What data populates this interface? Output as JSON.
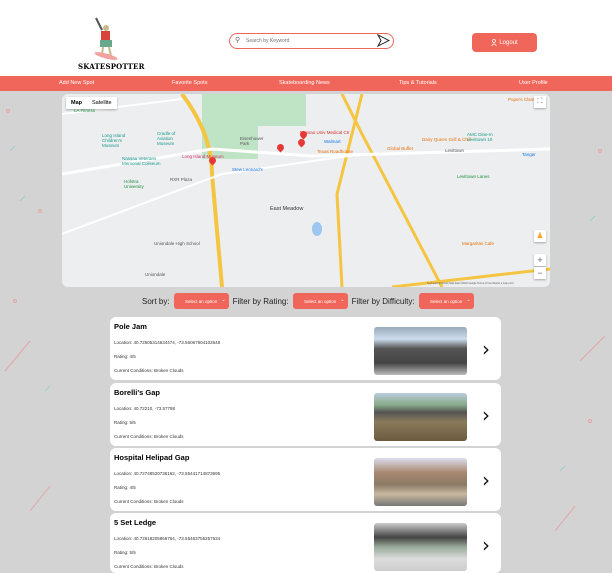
{
  "header": {
    "brand": "SKATESPOTTER",
    "search_placeholder": "Search by Keyword",
    "logout_label": "Logout"
  },
  "nav": [
    "Add New Spot",
    "Favorite Spots",
    "Skateboarding News",
    "Tips & Tutorials",
    "User Profile"
  ],
  "map": {
    "tabs": [
      "Map",
      "Satellite"
    ],
    "labels": [
      "East Meadow",
      "Levittown",
      "Uniondale",
      "Long Island Children's Museum",
      "Nassau Veterans Memorial Coliseum",
      "Long Island Museum",
      "Stew Leonard's",
      "Walmart",
      "Texas Roadhouse",
      "Global Buffet",
      "Levittown Lanes",
      "Uniondale High School",
      "RXR Plaza",
      "Hofstra University",
      "Dairy Queen Grill & Chill",
      "AMC Dine-In Levittown 10",
      "Tanger",
      "Margaritas Cafe",
      "Nassau Univ Medical Ctr",
      "Popei's Clam Bar",
      "LA Fitness",
      "Cradle of Aviation Museum",
      "Eisenhower Park"
    ],
    "zoom_in": "+",
    "zoom_out": "−",
    "attribution": "Keyboard shortcuts  Map data ©2023 Google  Terms of Use  Report a map error"
  },
  "filters": {
    "sort_label": "Sort by:",
    "rating_label": "Filter by Rating:",
    "difficulty_label": "Filter by Difficulty:",
    "placeholder": "Select an option"
  },
  "spots": [
    {
      "name": "Pole Jam",
      "location": "Location: 40.72505314634474, -73.56067904102648",
      "rating": "Rating: 4/5",
      "conditions": "Current Conditions: Broken Clouds"
    },
    {
      "name": "Borelli's Gap",
      "location": "Location: 40.72210, -73.57788",
      "rating": "Rating: 5/5",
      "conditions": "Current Conditions: Broken Clouds"
    },
    {
      "name": "Hospital Helipad Gap",
      "location": "Location: 40.72748520736162, -73.55441714873695",
      "rating": "Rating: 4/5",
      "conditions": "Current Conditions: Broken Clouds"
    },
    {
      "name": "5 Set Ledge",
      "location": "Location: 40.72618205866764, -73.55463755257534",
      "rating": "Rating: 5/5",
      "conditions": "Current Conditions: Broken Clouds"
    }
  ],
  "colors": {
    "accent": "#f0665a",
    "background": "#d3d3d3"
  }
}
